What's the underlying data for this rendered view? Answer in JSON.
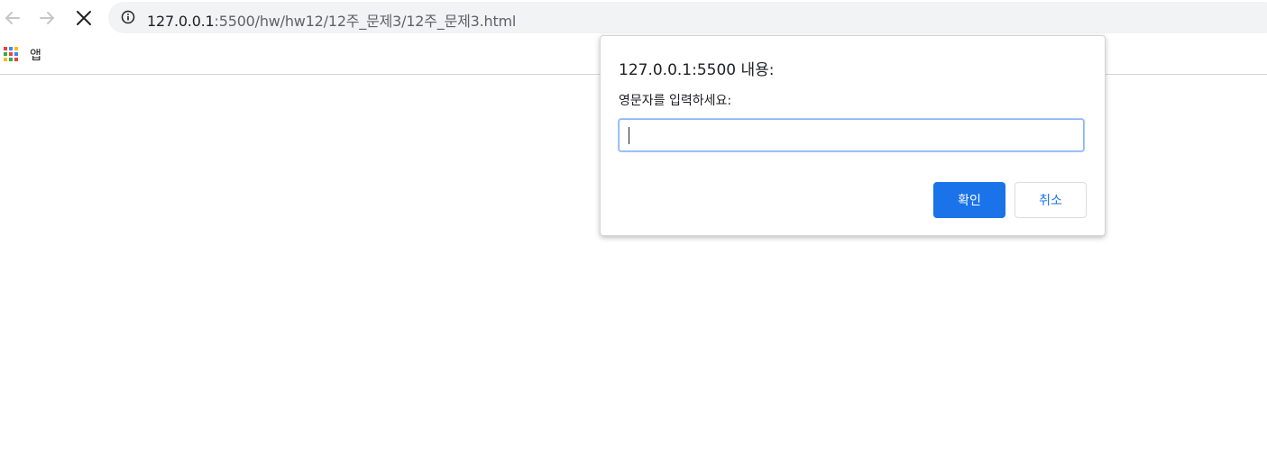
{
  "browser": {
    "back_icon": "arrow-left-icon",
    "forward_icon": "arrow-right-icon",
    "stop_icon": "close-icon",
    "info_icon": "info-icon",
    "url_host": "127.0.0.1",
    "url_path": ":5500/hw/hw12/12주_문제3/12주_문제3.html",
    "colors": {
      "icon": "#5f6368",
      "icon_disabled": "#c4c7c5",
      "omnibox_bg": "#f1f3f4"
    }
  },
  "bookmarks": {
    "apps_label": "앱",
    "apps_icon": "apps-grid-icon",
    "apps_colors": [
      "#ea4335",
      "#4285f4",
      "#fbbc05",
      "#34a853",
      "#ea4335",
      "#4285f4",
      "#fbbc05",
      "#34a853",
      "#ea4335"
    ]
  },
  "dialog": {
    "title": "127.0.0.1:5500 내용:",
    "message": "영문자를 입력하세요:",
    "input_value": "",
    "ok_label": "확인",
    "cancel_label": "취소",
    "colors": {
      "primary": "#1a73e8",
      "focus_ring": "#8ab4f8"
    }
  }
}
